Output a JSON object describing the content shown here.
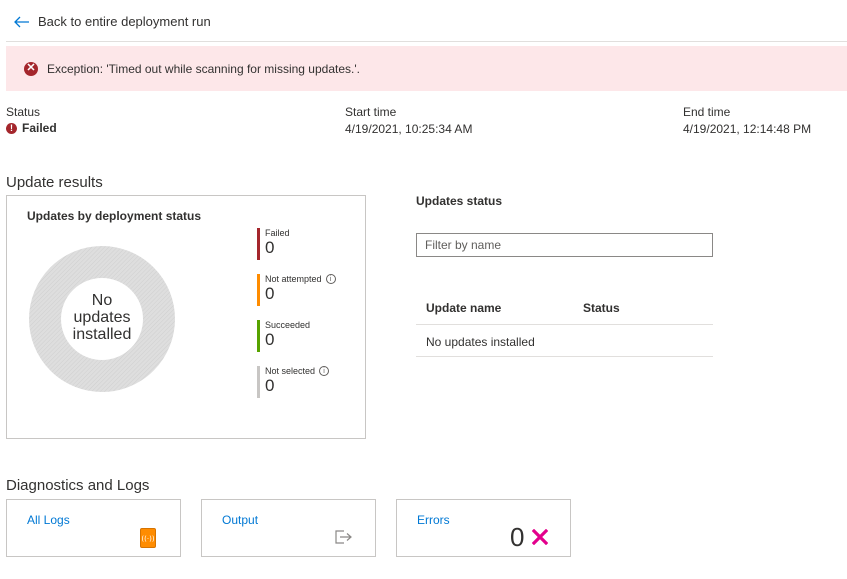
{
  "nav": {
    "back_label": "Back to entire deployment run"
  },
  "banner": {
    "message": "Exception: 'Timed out while scanning for missing updates.'."
  },
  "summary": {
    "status_label": "Status",
    "status_value": "Failed",
    "start_label": "Start time",
    "start_value": "4/19/2021, 10:25:34 AM",
    "end_label": "End time",
    "end_value": "4/19/2021, 12:14:48 PM"
  },
  "update_results": {
    "section_title": "Update results",
    "chart_title": "Updates by deployment status",
    "donut_text": "No updates installed",
    "legend": [
      {
        "name": "Failed",
        "value": "0",
        "color": "#a4262c",
        "info": false
      },
      {
        "name": "Not attempted",
        "value": "0",
        "color": "#ff8c00",
        "info": true
      },
      {
        "name": "Succeeded",
        "value": "0",
        "color": "#57a300",
        "info": false
      },
      {
        "name": "Not selected",
        "value": "0",
        "color": "#c8c6c4",
        "info": true
      }
    ]
  },
  "updates_status": {
    "title": "Updates status",
    "filter_placeholder": "Filter by name",
    "columns": [
      "Update name",
      "Status"
    ],
    "empty_text": "No updates installed"
  },
  "diagnostics": {
    "section_title": "Diagnostics and Logs",
    "all_logs_label": "All Logs",
    "output_label": "Output",
    "errors_label": "Errors",
    "errors_count": "0",
    "accent_error": "#e3008c",
    "accent_logs": "#ff8c00"
  },
  "icons": [
    "back-arrow-icon",
    "error-circle-icon",
    "failed-status-icon",
    "info-icon",
    "logs-icon",
    "output-icon",
    "error-x-icon"
  ]
}
